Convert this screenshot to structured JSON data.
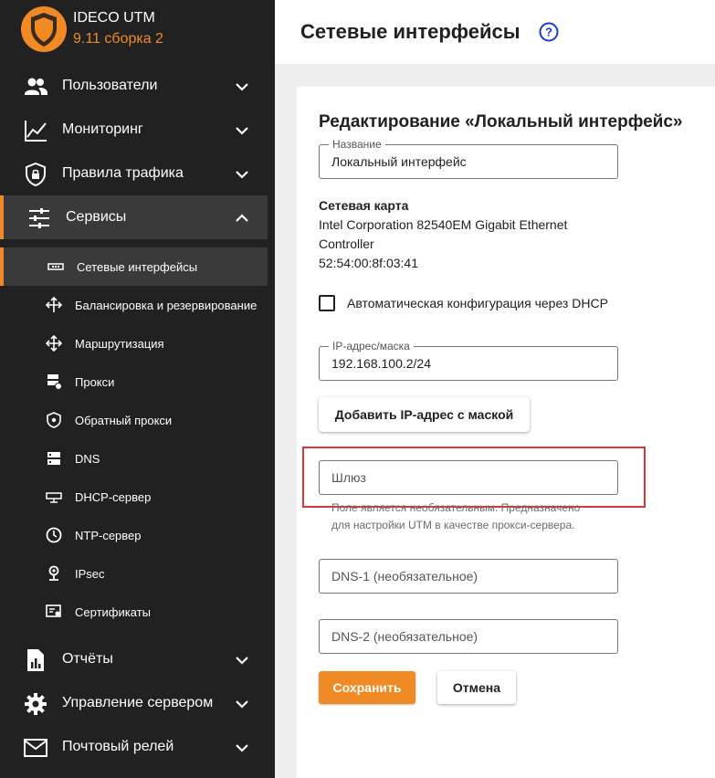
{
  "app": {
    "title": "IDECO UTM",
    "version": "9.11 сборка 2"
  },
  "colors": {
    "accent": "#f08a24",
    "sidebar": "#212121",
    "highlight": "#d9363e",
    "help": "#1a3ad4"
  },
  "sidebar": {
    "items": [
      {
        "label": "Пользователи",
        "icon": "users-icon"
      },
      {
        "label": "Мониторинг",
        "icon": "chart-line-icon"
      },
      {
        "label": "Правила трафика",
        "icon": "shield-lock-icon"
      },
      {
        "label": "Сервисы",
        "icon": "sliders-icon"
      },
      {
        "label": "Отчёты",
        "icon": "report-icon"
      },
      {
        "label": "Управление сервером",
        "icon": "gear-icon"
      },
      {
        "label": "Почтовый релей",
        "icon": "mail-icon"
      }
    ],
    "services_sub": [
      {
        "label": "Сетевые интерфейсы",
        "icon": "network-card-icon"
      },
      {
        "label": "Балансировка и резервирование",
        "icon": "balance-icon"
      },
      {
        "label": "Маршрутизация",
        "icon": "routing-icon"
      },
      {
        "label": "Прокси",
        "icon": "proxy-icon"
      },
      {
        "label": "Обратный прокси",
        "icon": "reverse-proxy-icon"
      },
      {
        "label": "DNS",
        "icon": "dns-icon"
      },
      {
        "label": "DHCP-сервер",
        "icon": "dhcp-icon"
      },
      {
        "label": "NTP-сервер",
        "icon": "clock-icon"
      },
      {
        "label": "IPsec",
        "icon": "ipsec-icon"
      },
      {
        "label": "Сертификаты",
        "icon": "certificate-icon"
      }
    ]
  },
  "header": {
    "title": "Сетевые интерфейсы"
  },
  "form": {
    "title": "Редактирование «Локальный интерфейс»",
    "name_label": "Название",
    "name_value": "Локальный интерфейс",
    "nic_title": "Сетевая карта",
    "nic_line1": "Intel Corporation 82540EM Gigabit Ethernet",
    "nic_line2": "Controller",
    "nic_mac": "52:54:00:8f:03:41",
    "dhcp_label": "Автоматическая конфигурация через DHCP",
    "dhcp_checked": false,
    "ip_label": "IP-адрес/маска",
    "ip_value": "192.168.100.2/24",
    "add_ip_button": "Добавить IP-адрес с маской",
    "gateway_placeholder": "Шлюз",
    "gateway_hint_1": "Поле является необязательным. Предназначено",
    "gateway_hint_2": "для настройки UTM в качестве прокси-сервера.",
    "dns1_placeholder": "DNS-1 (необязательное)",
    "dns2_placeholder": "DNS-2 (необязательное)",
    "save_button": "Сохранить",
    "cancel_button": "Отмена"
  }
}
